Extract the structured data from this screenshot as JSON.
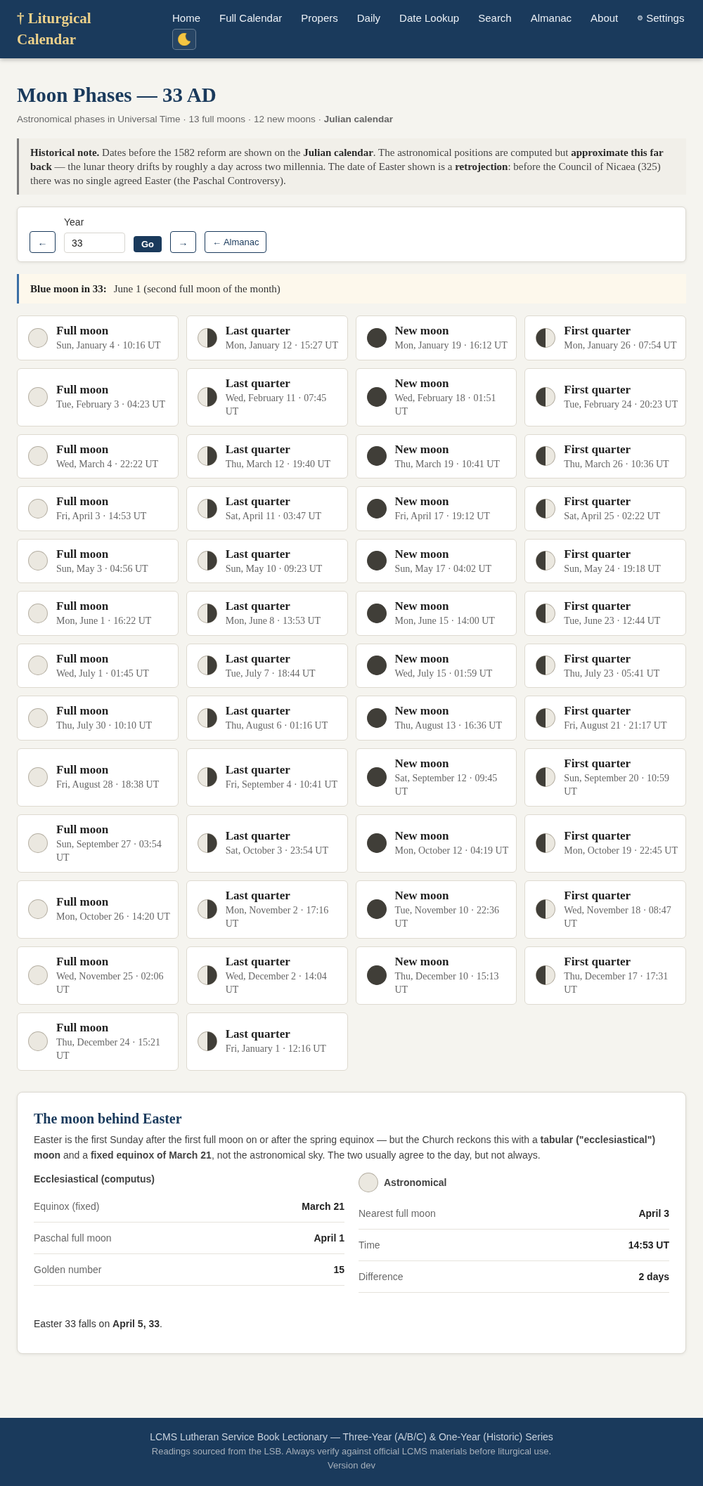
{
  "header": {
    "logo": "† Liturgical Calendar",
    "nav": [
      {
        "label": "Home"
      },
      {
        "label": "Full Calendar"
      },
      {
        "label": "Propers"
      },
      {
        "label": "Daily"
      },
      {
        "label": "Date Lookup"
      },
      {
        "label": "Search"
      },
      {
        "label": "Almanac"
      },
      {
        "label": "About"
      },
      {
        "label": "Settings",
        "glyph": "⚙"
      }
    ]
  },
  "page": {
    "title": "Moon Phases — 33 AD",
    "subtitle": "Astronomical phases in Universal Time · 13 full moons · 12 new moons · **Julian calendar**",
    "note": "**Historical note.** Dates before the 1582 reform are shown on the **Julian calendar**. The astronomical positions are computed but **approximate this far back** — the lunar theory drifts by roughly a day across two millennia. The date of Easter shown is a **retrojection**: before the Council of Nicaea (325) there was no single agreed Easter (the Paschal Controversy)."
  },
  "controls": {
    "prev": "←",
    "year_label": "Year",
    "year_value": "33",
    "go": "Go",
    "next": "→",
    "almanac": "← Almanac"
  },
  "blue_moon": {
    "label": "Blue moon in 33:",
    "text": "June 1 (second full moon of the month)"
  },
  "phases": [
    {
      "kind": "full",
      "title": "Full moon",
      "date": "Sun, January 4 · 10:16 UT"
    },
    {
      "kind": "last_quarter",
      "title": "Last quarter",
      "date": "Mon, January 12 · 15:27 UT"
    },
    {
      "kind": "new",
      "title": "New moon",
      "date": "Mon, January 19 · 16:12 UT"
    },
    {
      "kind": "first_quarter",
      "title": "First quarter",
      "date": "Mon, January 26 · 07:54 UT"
    },
    {
      "kind": "full",
      "title": "Full moon",
      "date": "Tue, February 3 · 04:23 UT"
    },
    {
      "kind": "last_quarter",
      "title": "Last quarter",
      "date": "Wed, February 11 · 07:45 UT"
    },
    {
      "kind": "new",
      "title": "New moon",
      "date": "Wed, February 18 · 01:51 UT"
    },
    {
      "kind": "first_quarter",
      "title": "First quarter",
      "date": "Tue, February 24 · 20:23 UT"
    },
    {
      "kind": "full",
      "title": "Full moon",
      "date": "Wed, March 4 · 22:22 UT"
    },
    {
      "kind": "last_quarter",
      "title": "Last quarter",
      "date": "Thu, March 12 · 19:40 UT"
    },
    {
      "kind": "new",
      "title": "New moon",
      "date": "Thu, March 19 · 10:41 UT"
    },
    {
      "kind": "first_quarter",
      "title": "First quarter",
      "date": "Thu, March 26 · 10:36 UT"
    },
    {
      "kind": "full",
      "title": "Full moon",
      "date": "Fri, April 3 · 14:53 UT"
    },
    {
      "kind": "last_quarter",
      "title": "Last quarter",
      "date": "Sat, April 11 · 03:47 UT"
    },
    {
      "kind": "new",
      "title": "New moon",
      "date": "Fri, April 17 · 19:12 UT"
    },
    {
      "kind": "first_quarter",
      "title": "First quarter",
      "date": "Sat, April 25 · 02:22 UT"
    },
    {
      "kind": "full",
      "title": "Full moon",
      "date": "Sun, May 3 · 04:56 UT"
    },
    {
      "kind": "last_quarter",
      "title": "Last quarter",
      "date": "Sun, May 10 · 09:23 UT"
    },
    {
      "kind": "new",
      "title": "New moon",
      "date": "Sun, May 17 · 04:02 UT"
    },
    {
      "kind": "first_quarter",
      "title": "First quarter",
      "date": "Sun, May 24 · 19:18 UT"
    },
    {
      "kind": "full",
      "title": "Full moon",
      "date": "Mon, June 1 · 16:22 UT"
    },
    {
      "kind": "last_quarter",
      "title": "Last quarter",
      "date": "Mon, June 8 · 13:53 UT"
    },
    {
      "kind": "new",
      "title": "New moon",
      "date": "Mon, June 15 · 14:00 UT"
    },
    {
      "kind": "first_quarter",
      "title": "First quarter",
      "date": "Tue, June 23 · 12:44 UT"
    },
    {
      "kind": "full",
      "title": "Full moon",
      "date": "Wed, July 1 · 01:45 UT"
    },
    {
      "kind": "last_quarter",
      "title": "Last quarter",
      "date": "Tue, July 7 · 18:44 UT"
    },
    {
      "kind": "new",
      "title": "New moon",
      "date": "Wed, July 15 · 01:59 UT"
    },
    {
      "kind": "first_quarter",
      "title": "First quarter",
      "date": "Thu, July 23 · 05:41 UT"
    },
    {
      "kind": "full",
      "title": "Full moon",
      "date": "Thu, July 30 · 10:10 UT"
    },
    {
      "kind": "last_quarter",
      "title": "Last quarter",
      "date": "Thu, August 6 · 01:16 UT"
    },
    {
      "kind": "new",
      "title": "New moon",
      "date": "Thu, August 13 · 16:36 UT"
    },
    {
      "kind": "first_quarter",
      "title": "First quarter",
      "date": "Fri, August 21 · 21:17 UT"
    },
    {
      "kind": "full",
      "title": "Full moon",
      "date": "Fri, August 28 · 18:38 UT"
    },
    {
      "kind": "last_quarter",
      "title": "Last quarter",
      "date": "Fri, September 4 · 10:41 UT"
    },
    {
      "kind": "new",
      "title": "New moon",
      "date": "Sat, September 12 · 09:45 UT"
    },
    {
      "kind": "first_quarter",
      "title": "First quarter",
      "date": "Sun, September 20 · 10:59 UT"
    },
    {
      "kind": "full",
      "title": "Full moon",
      "date": "Sun, September 27 · 03:54 UT"
    },
    {
      "kind": "last_quarter",
      "title": "Last quarter",
      "date": "Sat, October 3 · 23:54 UT"
    },
    {
      "kind": "new",
      "title": "New moon",
      "date": "Mon, October 12 · 04:19 UT"
    },
    {
      "kind": "first_quarter",
      "title": "First quarter",
      "date": "Mon, October 19 · 22:45 UT"
    },
    {
      "kind": "full",
      "title": "Full moon",
      "date": "Mon, October 26 · 14:20 UT"
    },
    {
      "kind": "last_quarter",
      "title": "Last quarter",
      "date": "Mon, November 2 · 17:16 UT"
    },
    {
      "kind": "new",
      "title": "New moon",
      "date": "Tue, November 10 · 22:36 UT"
    },
    {
      "kind": "first_quarter",
      "title": "First quarter",
      "date": "Wed, November 18 · 08:47 UT"
    },
    {
      "kind": "full",
      "title": "Full moon",
      "date": "Wed, November 25 · 02:06 UT"
    },
    {
      "kind": "last_quarter",
      "title": "Last quarter",
      "date": "Wed, December 2 · 14:04 UT"
    },
    {
      "kind": "new",
      "title": "New moon",
      "date": "Thu, December 10 · 15:13 UT"
    },
    {
      "kind": "first_quarter",
      "title": "First quarter",
      "date": "Thu, December 17 · 17:31 UT"
    },
    {
      "kind": "full",
      "title": "Full moon",
      "date": "Thu, December 24 · 15:21 UT"
    },
    {
      "kind": "last_quarter",
      "title": "Last quarter",
      "date": "Fri, January 1 · 12:16 UT"
    }
  ],
  "easter": {
    "title": "The moon behind Easter",
    "intro": "Easter is the first Sunday after the first full moon on or after the spring equinox — but the Church reckons this with a **tabular (\"ecclesiastical\") moon** and a **fixed equinox of March 21**, not the astronomical sky. The two usually agree to the day, but not always.",
    "columns": [
      {
        "kind": "plain",
        "heading": "Ecclesiastical (computus)",
        "rows": [
          {
            "label": "Equinox (fixed)",
            "value": "March 21"
          },
          {
            "label": "Paschal full moon",
            "value": "April 1"
          },
          {
            "label": "Golden number",
            "value": "15"
          }
        ]
      },
      {
        "kind": "moon",
        "heading": "Astronomical",
        "rows": [
          {
            "label": "Nearest full moon",
            "value": "April 3"
          },
          {
            "label": "Time",
            "value": "14:53 UT"
          },
          {
            "label": "Difference",
            "value": "2 days"
          }
        ]
      }
    ],
    "conclusion": "Easter 33 falls on **April 5, 33**."
  },
  "footer": {
    "title": "LCMS Lutheran Service Book Lectionary — Three-Year (A/B/C) & One-Year (Historic) Series",
    "note": "Readings sourced from the LSB. Always verify against official LCMS materials before liturgical use.",
    "version": "Version dev"
  }
}
